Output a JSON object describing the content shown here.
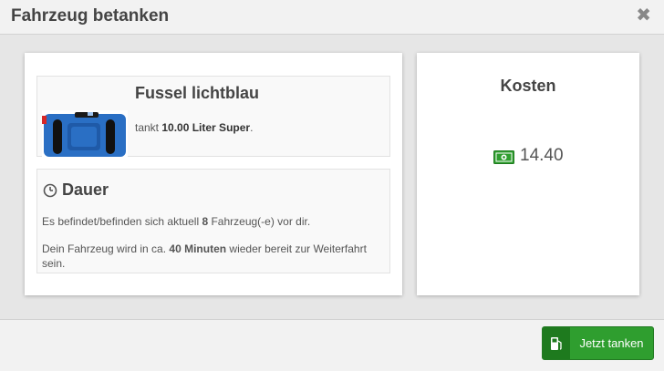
{
  "modal": {
    "title": "Fahrzeug betanken",
    "close_icon": "close-icon",
    "close_symbol": "✖"
  },
  "vehicle": {
    "name": "Fussel lichtblau",
    "desc_prefix": "tankt ",
    "desc_amount": "10.00 Liter Super",
    "desc_suffix": ".",
    "image_icon": "car-top-view-image",
    "car_color": "#2a6fc4"
  },
  "duration": {
    "title": "Dauer",
    "icon": "clock-icon",
    "line1_prefix": "Es befindet/befinden sich aktuell ",
    "line1_count": "8",
    "line1_suffix": " Fahrzeug(-e) vor dir.",
    "line2_prefix": "Dein Fahrzeug wird in ca. ",
    "line2_time": "40 Minuten",
    "line2_suffix": " wieder bereit zur Weiterfahrt sein."
  },
  "costs": {
    "title": "Kosten",
    "icon": "money-icon",
    "value": "14.40",
    "accent": "#2f9e2f"
  },
  "footer": {
    "button_label": "Jetzt tanken",
    "button_icon": "fuel-pump-icon",
    "button_color": "#2f9e2f"
  }
}
